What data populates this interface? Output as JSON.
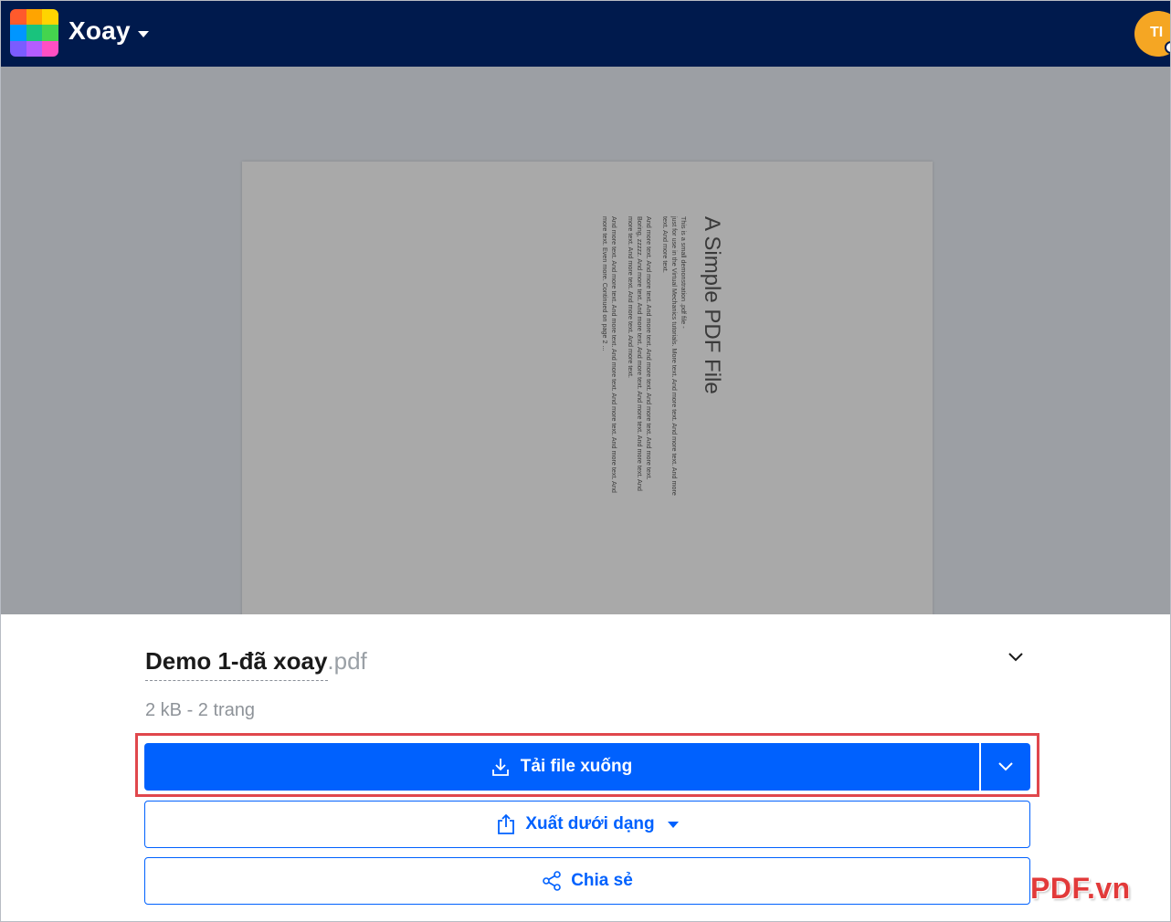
{
  "app": {
    "title": "Xoay",
    "avatar_initials": "TI",
    "logo_colors": [
      "#ff5a2c",
      "#ffa400",
      "#ffd400",
      "#0096ff",
      "#19c37d",
      "#44d44e",
      "#7b5cff",
      "#b45cff",
      "#ff4fc3"
    ]
  },
  "preview": {
    "pdf_title": "A Simple PDF File",
    "pdf_body_1": "This is a small demonstration .pdf file -",
    "pdf_body_2": "just for use in the Virtual Mechanics tutorials. More text. And more text. And more text. And more text. And more text.",
    "pdf_body_3": "And more text. And more text. And more text. And more text. And more text. And more text. Boring, zzzzz. And more text. And more text. And more text. And more text. And more text. And more text. And more text. And more text. And more text.",
    "pdf_body_4": "And more text. And more text. And more text. And more text. And more text. And more text. And more text. Even more. Continued on page 2 ..."
  },
  "file": {
    "name": "Demo 1-đã xoay",
    "ext": ".pdf",
    "meta": "2 kB - 2 trang"
  },
  "actions": {
    "download_label": "Tải file xuống",
    "export_label": "Xuất dưới dạng",
    "share_label": "Chia sẻ"
  },
  "watermark": "PDF.vn",
  "colors": {
    "topbar": "#001a4d",
    "primary": "#0061fe",
    "highlight": "#e0474c",
    "avatar": "#f5a623"
  }
}
